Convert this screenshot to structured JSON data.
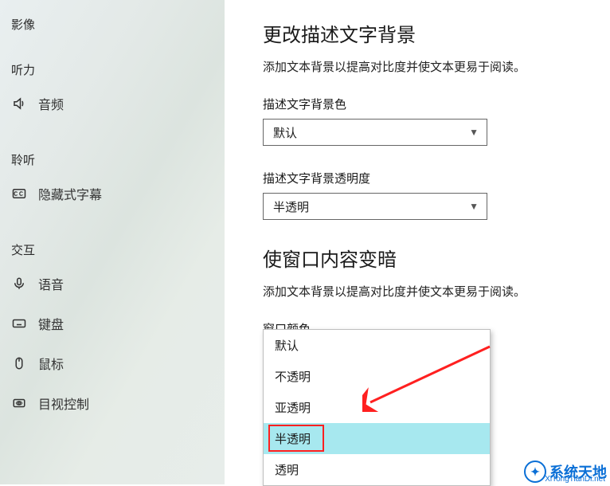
{
  "sidebar": {
    "groups": [
      {
        "label": "影像",
        "items": []
      },
      {
        "label": "听力",
        "items": [
          {
            "icon": "speaker-icon",
            "label": "音频"
          }
        ]
      },
      {
        "label": "聆听",
        "items": [
          {
            "icon": "cc-icon",
            "label": "隐藏式字幕"
          }
        ]
      },
      {
        "label": "交互",
        "items": [
          {
            "icon": "microphone-icon",
            "label": "语音"
          },
          {
            "icon": "keyboard-icon",
            "label": "键盘"
          },
          {
            "icon": "mouse-icon",
            "label": "鼠标"
          },
          {
            "icon": "eye-control-icon",
            "label": "目视控制"
          }
        ]
      }
    ]
  },
  "main": {
    "section1": {
      "title": "更改描述文字背景",
      "desc": "添加文本背景以提高对比度并使文本更易于阅读。",
      "field1": {
        "label": "描述文字背景色",
        "value": "默认"
      },
      "field2": {
        "label": "描述文字背景透明度",
        "value": "半透明"
      }
    },
    "section2": {
      "title": "使窗口内容变暗",
      "desc": "添加文本背景以提高对比度并使文本更易于阅读。",
      "field1": {
        "label": "窗口颜色"
      }
    }
  },
  "dropdown": {
    "options": [
      "默认",
      "不透明",
      "亚透明",
      "半透明",
      "透明"
    ],
    "selected_index": 3
  },
  "watermark": {
    "text": "系统天地",
    "url": "XiTongTianDi.net"
  }
}
